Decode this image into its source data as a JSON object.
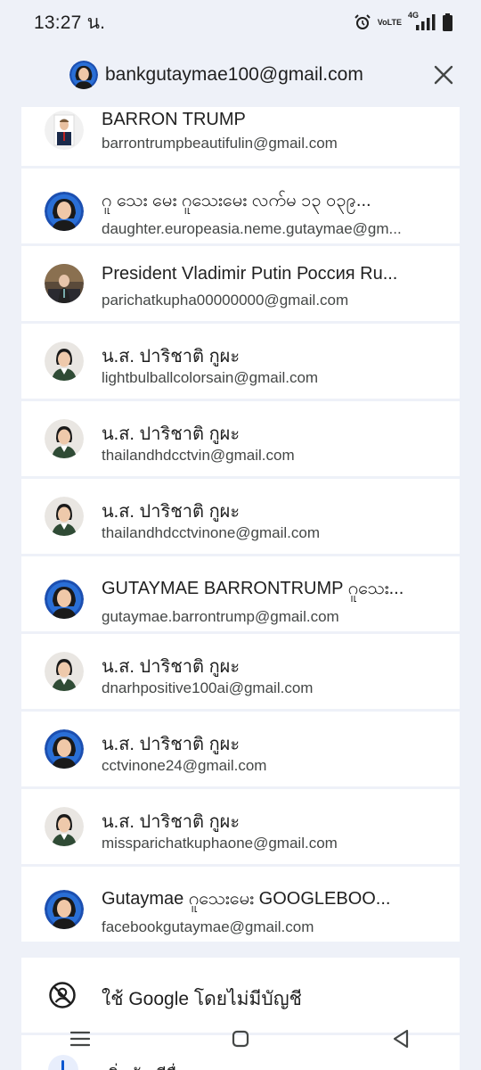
{
  "status": {
    "time": "13:27 น.",
    "volte_top": "Vo",
    "volte_bottom": "LTE",
    "network": "4G"
  },
  "header": {
    "email": "bankgutaymae100@gmail.com",
    "close_icon": "close-icon"
  },
  "accounts": [
    {
      "name": "BARRON TRUMP",
      "email": "barrontrumpbeautifulin@gmail.com",
      "avatar": "suit-man"
    },
    {
      "name": "ဂူ သေး မေး ဂူသေးမေး လက်မ ၁၃ ၀၃၉...",
      "email": "daughter.europeasia.neme.gutaymae@gm...",
      "avatar": "woman-blue"
    },
    {
      "name": "President Vladimir Putin Россия Ru...",
      "email": "parichatkupha00000000@gmail.com",
      "avatar": "man-office"
    },
    {
      "name": "น.ส. ปาริชาติ กูผะ",
      "email": "lightbulballcolorsain@gmail.com",
      "avatar": "girl-uniform"
    },
    {
      "name": "น.ส. ปาริชาติ กูผะ",
      "email": "thailandhdcctvin@gmail.com",
      "avatar": "girl-uniform"
    },
    {
      "name": "น.ส. ปาริชาติ กูผะ",
      "email": "thailandhdcctvinone@gmail.com",
      "avatar": "girl-uniform"
    },
    {
      "name": "GUTAYMAE BARRONTRUMP ဂူသေး...",
      "email": "gutaymae.barrontrump@gmail.com",
      "avatar": "woman-blue"
    },
    {
      "name": "น.ส. ปาริชาติ กูผะ",
      "email": "dnarhpositive100ai@gmail.com",
      "avatar": "girl-uniform"
    },
    {
      "name": "น.ส. ปาริชาติ กูผะ",
      "email": "cctvinone24@gmail.com",
      "avatar": "woman-blue"
    },
    {
      "name": "น.ส. ปาริชาติ กูผะ",
      "email": "missparichatkuphaone@gmail.com",
      "avatar": "girl-uniform"
    },
    {
      "name": "Gutaymae ဂူသေးမေး GOOGLEBOO...",
      "email": "facebookgutaymae@gmail.com",
      "avatar": "woman-blue"
    }
  ],
  "no_account": {
    "label": "ใช้ Google โดยไม่มีบัญชี",
    "icon": "no-account-icon"
  },
  "next_option": {
    "label": "เพิ่มบัญชีอื่น"
  },
  "navbar": {
    "recent": "menu-icon",
    "home": "home-icon",
    "back": "back-icon"
  },
  "colors": {
    "background": "#eef1f8",
    "card": "#ffffff",
    "primary_text": "#1f1f1f",
    "secondary_text": "#444746",
    "accent": "#0b57d0"
  }
}
